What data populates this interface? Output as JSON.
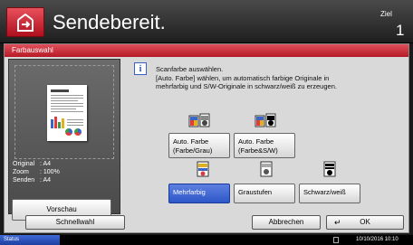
{
  "header": {
    "title": "Sendebereit.",
    "dest_label": "Ziel",
    "dest_count": "1"
  },
  "tab": {
    "label": "Farbauswahl"
  },
  "preview": {
    "original_key": "Original",
    "original_val": ": A4",
    "zoom_key": "Zoom",
    "zoom_val": ": 100%",
    "send_key": "Senden",
    "send_val": ": A4",
    "button_label": "Vorschau"
  },
  "message": {
    "line1": "Scanfarbe auswählen.",
    "line2": "[Auto. Farbe] wählen, um automatisch farbige Originale in",
    "line3": "mehrfarbig und S/W-Originale in schwarz/weiß zu erzeugen."
  },
  "options": {
    "auto_color_gray": {
      "line1": "Auto. Farbe",
      "line2": "(Farbe/Grau)"
    },
    "auto_color_bw": {
      "line1": "Auto. Farbe",
      "line2": "(Farbe&S/W)"
    },
    "full_color": "Mehrfarbig",
    "grayscale": "Graustufen",
    "bw": "Schwarz/weiß",
    "selected": "Mehrfarbig"
  },
  "footer": {
    "quick_setup": "Schnellwahl",
    "cancel": "Abbrechen",
    "ok": "OK"
  },
  "statusbar": {
    "status_label": "Status",
    "datetime": "10/10/2016  10:10"
  },
  "colors": {
    "accent_red": "#c8202e",
    "selected_blue": "#2d57c8"
  }
}
